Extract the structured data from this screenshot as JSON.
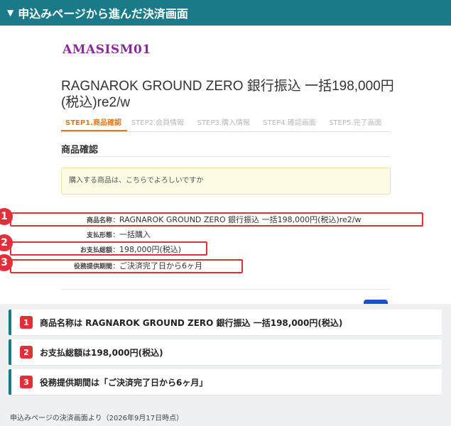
{
  "header": {
    "title": "申込みページから進んだ決済画面",
    "marker": "▼"
  },
  "shop": {
    "logo_text": "AMASISM01"
  },
  "product": {
    "title": "RAGNAROK GROUND ZERO 銀行振込 一括198,000円(税込)re2/w"
  },
  "steps": [
    {
      "label": "STEP1.商品確認",
      "active": true
    },
    {
      "label": "STEP2.会員情報",
      "active": false
    },
    {
      "label": "STEP3.購入情報",
      "active": false
    },
    {
      "label": "STEP4.確認画面",
      "active": false
    },
    {
      "label": "STEP5.完了画面",
      "active": false
    }
  ],
  "section": {
    "title": "商品確認"
  },
  "notice": {
    "text": "購入する商品は、こちらでよろしいですか"
  },
  "details": [
    {
      "label": "商品名称",
      "value": "RAGNAROK GROUND ZERO 銀行振込 一括198,000円(税込)re2/w"
    },
    {
      "label": "支払形態",
      "value": "一括購入"
    },
    {
      "label": "お支払総額",
      "value": "198,000円(税込)"
    },
    {
      "label": "役務提供期間",
      "value": "ご決済完了日から6ヶ月"
    }
  ],
  "markers": [
    "1",
    "2",
    "3"
  ],
  "callouts": [
    {
      "num": "1",
      "text": "商品名称は RAGNAROK GROUND ZERO 銀行振込 一括198,000円(税込)"
    },
    {
      "num": "2",
      "text": "お支払総額は198,000円(税込)"
    },
    {
      "num": "3",
      "text": "役務提供期間は「ご決済完了日から6ヶ月」"
    }
  ],
  "caption": {
    "text": "申込みページの決済画面より（2026年9月17日時点）"
  },
  "colors": {
    "header_bg": "#1b7a87",
    "accent_red": "#e0303a",
    "step_active": "#e07a1f",
    "logo": "#8a2a9a"
  }
}
